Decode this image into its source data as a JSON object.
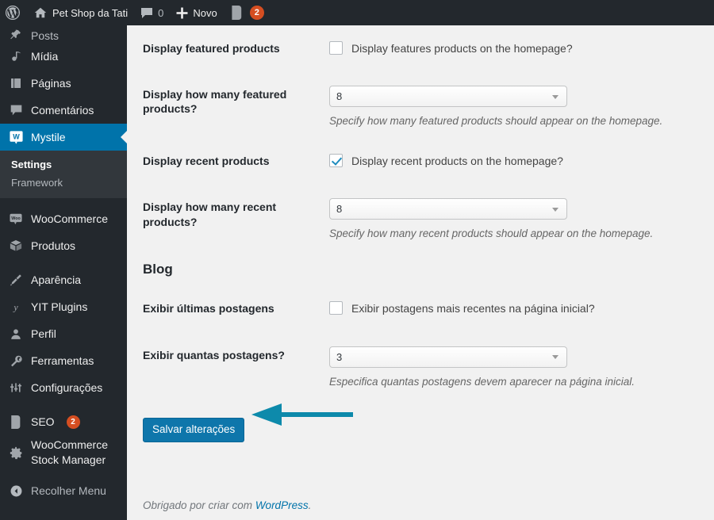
{
  "adminbar": {
    "wp_logo_icon": "wordpress-logo-icon",
    "site_home_icon": "home-icon",
    "site_name": "Pet Shop da Tati",
    "comments_icon": "comment-bubble-icon",
    "comments_count": "0",
    "new_icon": "plus-icon",
    "new_label": "Novo",
    "yoast_icon": "yoast-seo-icon",
    "yoast_badge": "2"
  },
  "sidebar": {
    "items": [
      {
        "label": "Posts",
        "icon": "pin-icon",
        "clipped": true
      },
      {
        "label": "Mídia",
        "icon": "media-icon"
      },
      {
        "label": "Páginas",
        "icon": "pages-icon"
      },
      {
        "label": "Comentários",
        "icon": "comment-bubble-icon"
      },
      {
        "label": "Mystile",
        "icon": "mystile-w-icon",
        "current": true
      },
      {
        "label": "WooCommerce",
        "icon": "woocommerce-icon"
      },
      {
        "label": "Produtos",
        "icon": "product-box-icon"
      },
      {
        "label": "Aparência",
        "icon": "paintbrush-icon"
      },
      {
        "label": "YIT Plugins",
        "icon": "yith-icon"
      },
      {
        "label": "Perfil",
        "icon": "user-icon"
      },
      {
        "label": "Ferramentas",
        "icon": "wrench-icon"
      },
      {
        "label": "Configurações",
        "icon": "sliders-icon"
      },
      {
        "label": "SEO",
        "icon": "yoast-seo-icon",
        "badge": "2"
      },
      {
        "label": "WooCommerce Stock Manager",
        "icon": "gear-icon"
      },
      {
        "label": "Recolher Menu",
        "icon": "collapse-arrow-icon"
      }
    ],
    "submenu": [
      {
        "label": "Settings",
        "current": true
      },
      {
        "label": "Framework",
        "current": false
      }
    ]
  },
  "main": {
    "rows": [
      {
        "label": "Display featured products",
        "type": "checkbox",
        "checked": false,
        "checkbox_text": "Display features products on the homepage?"
      },
      {
        "label": "Display how many featured products?",
        "type": "select",
        "value": "8",
        "description": "Specify how many featured products should appear on the homepage."
      },
      {
        "label": "Display recent products",
        "type": "checkbox",
        "checked": true,
        "checkbox_text": "Display recent products on the homepage?"
      },
      {
        "label": "Display how many recent products?",
        "type": "select",
        "value": "8",
        "description": "Specify how many recent products should appear on the homepage."
      }
    ],
    "blog_heading": "Blog",
    "blog_rows": [
      {
        "label": "Exibir últimas postagens",
        "type": "checkbox",
        "checked": false,
        "checkbox_text": "Exibir postagens mais recentes na página inicial?"
      },
      {
        "label": "Exibir quantas postagens?",
        "type": "select",
        "value": "3",
        "description": "Especifica quantas postagens devem aparecer na página inicial."
      }
    ],
    "save_button": "Salvar alterações",
    "annotation_arrow_icon": "left-arrow-annotation-icon"
  },
  "footer": {
    "text_before": "Obrigado por criar com ",
    "link_text": "WordPress",
    "text_after": "."
  },
  "colors": {
    "admin_bar": "#23282d",
    "sidebar": "#23282d",
    "submenu": "#32373c",
    "current_menu": "#0073aa",
    "content_bg": "#f1f1f1",
    "primary_button": "#0e76ab",
    "badge": "#d54e21",
    "checkmark": "#1e8cbe",
    "annotation_arrow": "#0d8aab",
    "link": "#0073aa"
  }
}
